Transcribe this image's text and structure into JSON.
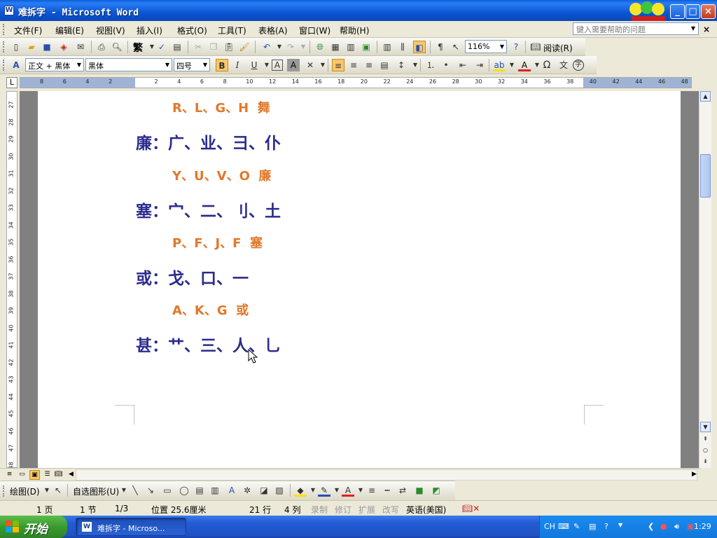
{
  "window": {
    "title": "难拆字 - Microsoft Word",
    "app_icon": "word-icon",
    "logo": "logo-image",
    "controls": [
      "minimize-icon",
      "maximize-icon",
      "close-icon"
    ]
  },
  "menubar": {
    "items": [
      {
        "label": "文件(F)"
      },
      {
        "label": "编辑(E)"
      },
      {
        "label": "视图(V)"
      },
      {
        "label": "插入(I)"
      },
      {
        "label": "格式(O)"
      },
      {
        "label": "工具(T)"
      },
      {
        "label": "表格(A)"
      },
      {
        "label": "窗口(W)"
      },
      {
        "label": "帮助(H)"
      }
    ],
    "help_placeholder": "键入需要帮助的问题",
    "close_glyph": "×"
  },
  "standard_toolbar": {
    "zoom": "116%",
    "read_label": "阅读(R)",
    "traditional_label": "繁"
  },
  "format_toolbar": {
    "style": "正文 + 黑体",
    "font": "黑体",
    "size": "四号",
    "bold": "B",
    "italic": "I",
    "underline": "U"
  },
  "ruler": {
    "tabsel": "L",
    "top_numbers": [
      "8",
      "6",
      "4",
      "2",
      "",
      "2",
      "4",
      "6",
      "8",
      "10",
      "12",
      "14",
      "16",
      "18",
      "20",
      "22",
      "24",
      "26",
      "28",
      "30",
      "32",
      "34",
      "36",
      "38",
      "40",
      "42",
      "44",
      "46",
      "48"
    ],
    "left_numbers": [
      "27",
      "28",
      "29",
      "30",
      "31",
      "32",
      "33",
      "34",
      "35",
      "36",
      "37",
      "38",
      "39",
      "40",
      "41",
      "42",
      "43",
      "44",
      "45",
      "46",
      "47",
      "48"
    ]
  },
  "document": {
    "lines": [
      {
        "text": "R、L、G、H  舞",
        "style": "key"
      },
      {
        "text": "廉：广、业、彐、仆",
        "style": "big"
      },
      {
        "text": "Y、U、V、O  廉",
        "style": "key"
      },
      {
        "text": "塞：宀、二、刂、土",
        "style": "big"
      },
      {
        "text": "P、F、J、F  塞",
        "style": "key"
      },
      {
        "text": "或：戈、口、一",
        "style": "big"
      },
      {
        "text": "A、K、G  或",
        "style": "key"
      },
      {
        "text": "甚：艹、三、人、乚",
        "style": "big"
      }
    ]
  },
  "drawing_toolbar": {
    "draw_label": "绘图(D)",
    "autoshape_label": "自选图形(U)"
  },
  "statusbar": {
    "page": "1 页",
    "section": "1 节",
    "pages": "1/3",
    "position": "位置 25.6厘米",
    "line": "21 行",
    "column": "4 列",
    "rec": "录制",
    "trk": "修订",
    "ext": "扩展",
    "ovr": "改写",
    "language": "英语(美国)"
  },
  "taskbar": {
    "start": "开始",
    "task": "难拆字 - Microso...",
    "lang": "CH",
    "clock": "1:29"
  }
}
